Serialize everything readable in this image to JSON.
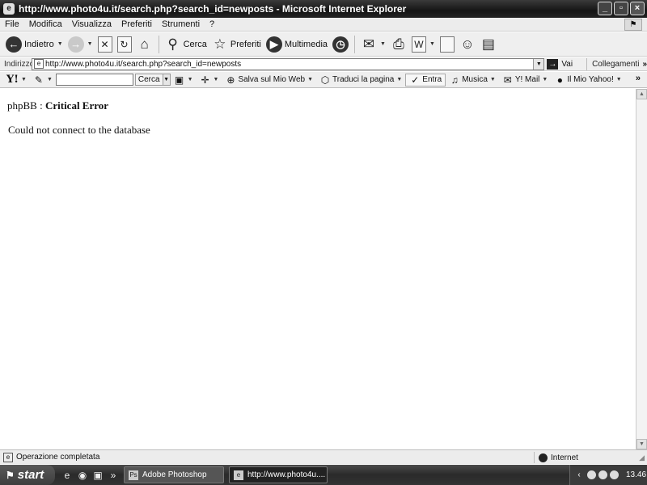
{
  "window": {
    "title": "http://www.photo4u.it/search.php?search_id=newposts - Microsoft Internet Explorer",
    "title_icon": "e",
    "minimize": "_",
    "maximize": "▫",
    "close": "×"
  },
  "menubar": {
    "items": [
      "File",
      "Modifica",
      "Visualizza",
      "Preferiti",
      "Strumenti",
      "?"
    ]
  },
  "toolbar": {
    "back_label": "Indietro",
    "search_label": "Cerca",
    "favorites_label": "Preferiti",
    "media_label": "Multimedia"
  },
  "address": {
    "label": "Indirizzo",
    "url": "http://www.photo4u.it/search.php?search_id=newposts",
    "go_label": "Vai",
    "links_label": "Collegamenti"
  },
  "yahoo_toolbar": {
    "logo": "Y!",
    "search_placeholder": "",
    "search_button": "Cerca",
    "save_label": "Salva sul Mio Web",
    "translate_label": "Traduci la pagina",
    "enter_label": "Entra",
    "music_label": "Musica",
    "mail_label": "Y! Mail",
    "my_yahoo_label": "Il Mio Yahoo!"
  },
  "page": {
    "prefix": "phpBB : ",
    "error_title": "Critical Error",
    "error_message": "Could not connect to the database"
  },
  "status": {
    "text": "Operazione completata",
    "zone": "Internet"
  },
  "taskbar": {
    "start_label": "start",
    "tasks": [
      {
        "label": "Adobe Photoshop",
        "active": false
      },
      {
        "label": "http://www.photo4u....",
        "active": true
      }
    ],
    "time": "13.46"
  }
}
